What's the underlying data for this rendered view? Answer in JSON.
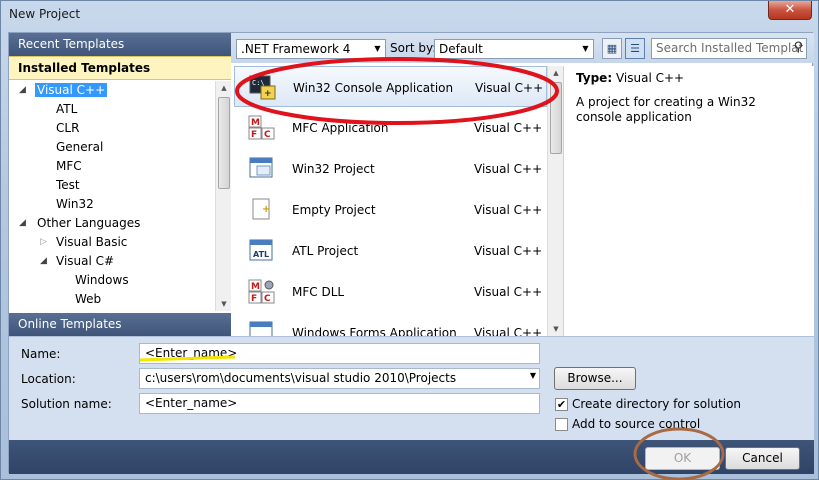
{
  "window": {
    "title": "New Project",
    "close_glyph": "✕"
  },
  "left_panel": {
    "recent_header": "Recent Templates",
    "installed_header": "Installed Templates",
    "online_header": "Online Templates",
    "tree": [
      {
        "label": "Visual C++",
        "expanded": true,
        "selected": true
      },
      {
        "label": "ATL"
      },
      {
        "label": "CLR"
      },
      {
        "label": "General"
      },
      {
        "label": "MFC"
      },
      {
        "label": "Test"
      },
      {
        "label": "Win32"
      },
      {
        "label": "Other Languages",
        "expanded": true
      },
      {
        "label": "Visual Basic",
        "expanded": false
      },
      {
        "label": "Visual C#",
        "expanded": true
      },
      {
        "label": "Windows"
      },
      {
        "label": "Web"
      }
    ]
  },
  "toolbar": {
    "framework": ".NET Framework 4",
    "sort_label": "Sort by:",
    "sort_value": "Default",
    "search_placeholder": "Search Installed Templat"
  },
  "templates": [
    {
      "name": "Win32 Console Application",
      "language": "Visual C++",
      "icon": "console-app-icon",
      "selected": true
    },
    {
      "name": "MFC Application",
      "language": "Visual C++",
      "icon": "mfc-icon"
    },
    {
      "name": "Win32 Project",
      "language": "Visual C++",
      "icon": "window-icon"
    },
    {
      "name": "Empty Project",
      "language": "Visual C++",
      "icon": "empty-project-icon"
    },
    {
      "name": "ATL Project",
      "language": "Visual C++",
      "icon": "atl-icon"
    },
    {
      "name": "MFC DLL",
      "language": "Visual C++",
      "icon": "mfc-icon"
    },
    {
      "name": "Windows Forms Application",
      "language": "Visual C++",
      "icon": "forms-icon"
    }
  ],
  "details": {
    "type_label": "Type:",
    "type_value": "Visual C++",
    "description": "A project for creating a Win32 console application"
  },
  "form": {
    "name_label": "Name:",
    "name_value": "<Enter_name>",
    "location_label": "Location:",
    "location_value": "c:\\users\\rom\\documents\\visual studio 2010\\Projects",
    "solution_label": "Solution name:",
    "solution_value": "<Enter_name>",
    "browse_label": "Browse...",
    "create_dir_label": "Create directory for solution",
    "create_dir_checked": true,
    "source_control_label": "Add to source control",
    "source_control_checked": false
  },
  "buttons": {
    "ok": "OK",
    "cancel": "Cancel"
  },
  "colors": {
    "annotation_red": "#e0121b",
    "annotation_brown": "#a86a43",
    "annotation_yellow": "#f2e600",
    "selection": "#3399ff"
  }
}
